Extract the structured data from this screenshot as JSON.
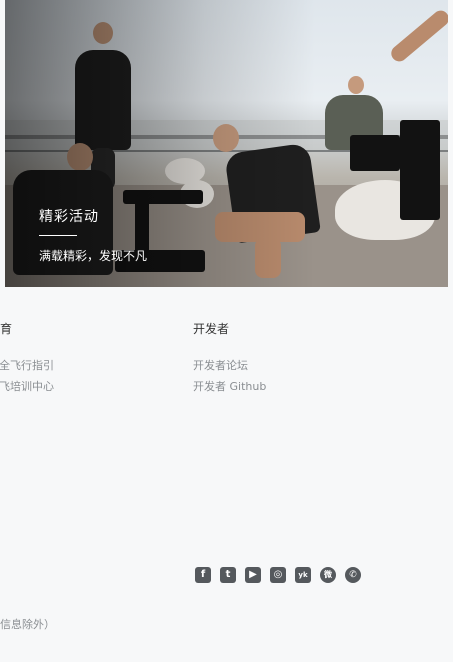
{
  "hero": {
    "title": "精彩活动",
    "subtitle": "满载精彩，发现不凡"
  },
  "columns": [
    {
      "heading": "教育",
      "links": [
        "安全飞行指引",
        "慧飞培训中心"
      ]
    },
    {
      "heading": "开发者",
      "links": [
        "开发者论坛",
        "开发者 Github"
      ]
    }
  ],
  "social": {
    "icons": [
      {
        "name": "facebook-icon",
        "glyph": "f"
      },
      {
        "name": "twitter-icon",
        "glyph": "t"
      },
      {
        "name": "youtube-icon",
        "glyph": "▶"
      },
      {
        "name": "instagram-icon",
        "glyph": "◎"
      },
      {
        "name": "youku-icon",
        "glyph": "yk"
      },
      {
        "name": "weibo-icon",
        "glyph": "微"
      },
      {
        "name": "wechat-icon",
        "glyph": "✆"
      }
    ]
  },
  "footer": {
    "note": "信息除外）"
  }
}
